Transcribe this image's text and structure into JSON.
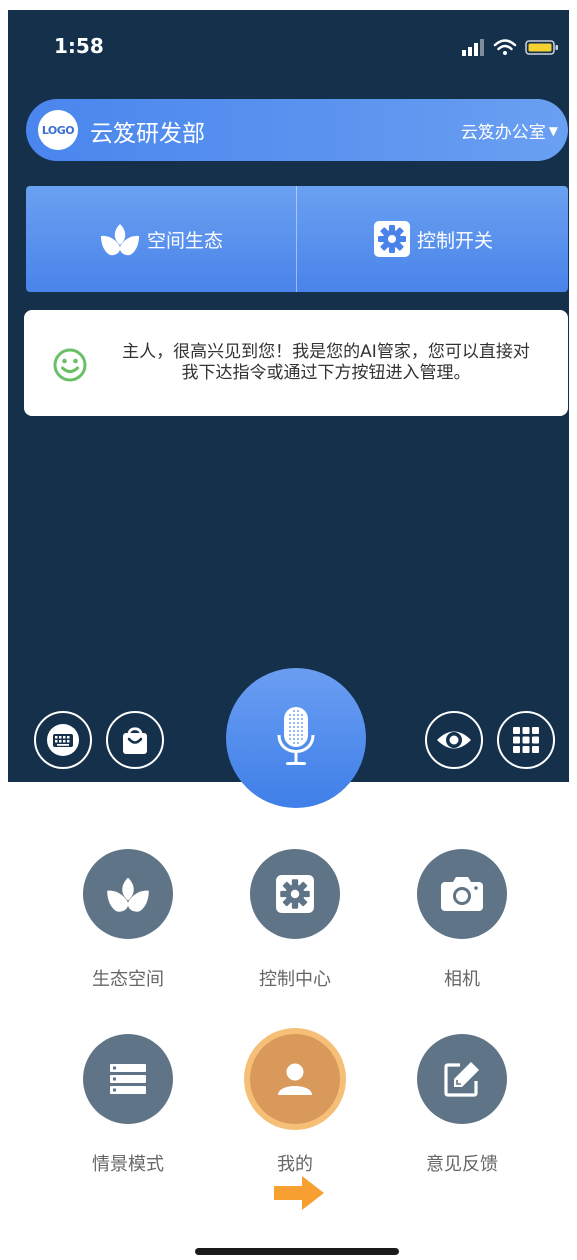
{
  "status_bar": {
    "time": "1:58"
  },
  "header": {
    "logo_text": "LOGO",
    "org_name": "云笈研发部",
    "office": "云笈办公室"
  },
  "quick_actions": [
    {
      "label": "空间生态",
      "icon": "sprout-icon"
    },
    {
      "label": "控制开关",
      "icon": "gear-icon"
    }
  ],
  "message": {
    "text": "主人，很高兴见到您！我是您的AI管家，您可以直接对我下达指令或通过下方按钮进入管理。"
  },
  "toolbar": {
    "left": [
      "keyboard-icon",
      "shopping-bag-icon"
    ],
    "center": "microphone-icon",
    "right": [
      "eye-icon",
      "grid-icon"
    ]
  },
  "grid": [
    {
      "label": "生态空间",
      "icon": "sprout-icon"
    },
    {
      "label": "控制中心",
      "icon": "gear-icon"
    },
    {
      "label": "相机",
      "icon": "camera-icon"
    },
    {
      "label": "情景模式",
      "icon": "list-icon"
    },
    {
      "label": "我的",
      "icon": "user-icon"
    },
    {
      "label": "意见反馈",
      "icon": "edit-icon"
    }
  ],
  "colors": {
    "dark_bg": "#14304b",
    "accent_blue": "#4a86ee",
    "icon_gray": "#607487",
    "profile_orange": "#d9995b",
    "arrow_orange": "#f7a031"
  }
}
